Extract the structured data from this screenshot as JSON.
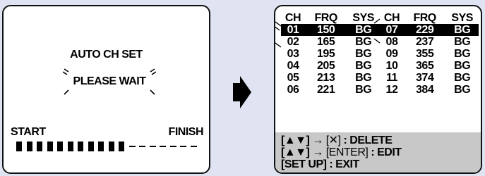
{
  "left_screen": {
    "title": "AUTO CH SET",
    "status": "PLEASE WAIT",
    "progress_start_label": "START",
    "progress_finish_label": "FINISH",
    "progress_filled_segments": 11,
    "progress_total_segments": 18
  },
  "right_screen": {
    "headers": [
      "CH",
      "FRQ",
      "SYS",
      "CH",
      "FRQ",
      "SYS"
    ],
    "rows": [
      {
        "ch1": "01",
        "frq1": "150",
        "sys1": "BG",
        "ch2": "07",
        "frq2": "229",
        "sys2": "BG"
      },
      {
        "ch1": "02",
        "frq1": "165",
        "sys1": "BG",
        "ch2": "08",
        "frq2": "237",
        "sys2": "BG"
      },
      {
        "ch1": "03",
        "frq1": "195",
        "sys1": "BG",
        "ch2": "09",
        "frq2": "355",
        "sys2": "BG"
      },
      {
        "ch1": "04",
        "frq1": "205",
        "sys1": "BG",
        "ch2": "10",
        "frq2": "365",
        "sys2": "BG"
      },
      {
        "ch1": "05",
        "frq1": "213",
        "sys1": "BG",
        "ch2": "11",
        "frq2": "374",
        "sys2": "BG"
      },
      {
        "ch1": "06",
        "frq1": "221",
        "sys1": "BG",
        "ch2": "12",
        "frq2": "384",
        "sys2": "BG"
      }
    ],
    "help": {
      "delete_keys": "[▲▼]",
      "delete_arrow": "→",
      "delete_target": "[✕]",
      "delete_action": ": DELETE",
      "edit_keys": "[▲▼]",
      "edit_arrow": "→",
      "edit_target": "[ENTER]",
      "edit_action": ": EDIT",
      "exit_text": "[SET UP] : EXIT"
    }
  },
  "icons": {
    "transition_arrow": "right-arrow-icon",
    "blink_marks": "flash-icon"
  },
  "colors": {
    "page_background": "#dfe3f2",
    "screen_background": "#ffffff",
    "highlight_background": "#000000",
    "help_panel_background": "#c8c8c8"
  }
}
